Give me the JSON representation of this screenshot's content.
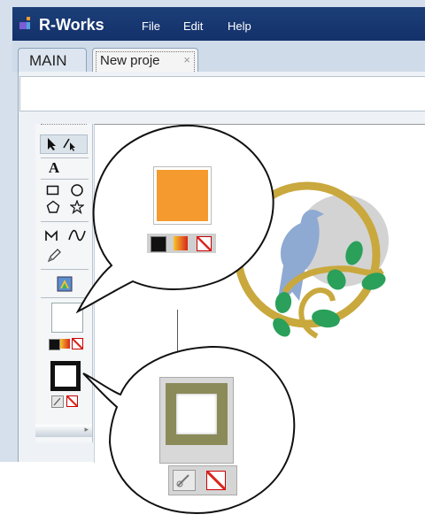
{
  "app": {
    "title": "R-Works"
  },
  "menu": {
    "file": "File",
    "edit": "Edit",
    "help": "Help"
  },
  "tabs": [
    {
      "label": "MAIN"
    },
    {
      "label": "New proje",
      "close": "×"
    }
  ],
  "toolbox": {
    "text_tool": "A",
    "footer": "▸"
  },
  "colors": {
    "title_bar": "#13306a",
    "fill_swatch": "#f59a2f",
    "stroke_swatch": "#8b8b5a",
    "badge_gold": "#c9a83d",
    "bird": "#8faad2",
    "leaf": "#2aa05a",
    "moon": "#d3d3d3"
  },
  "icons": {
    "selection": "arrow-icon",
    "direct_selection": "direct-select-icon",
    "text": "text-icon",
    "rectangle": "rectangle-icon",
    "ellipse": "ellipse-icon",
    "polygon": "pentagon-icon",
    "star": "star-icon",
    "pen": "pen-icon",
    "curve": "curve-icon",
    "pencil": "pencil-icon",
    "gradient": "gradient-tool-icon",
    "swap": "swap-icon",
    "no_color": "none-icon"
  }
}
